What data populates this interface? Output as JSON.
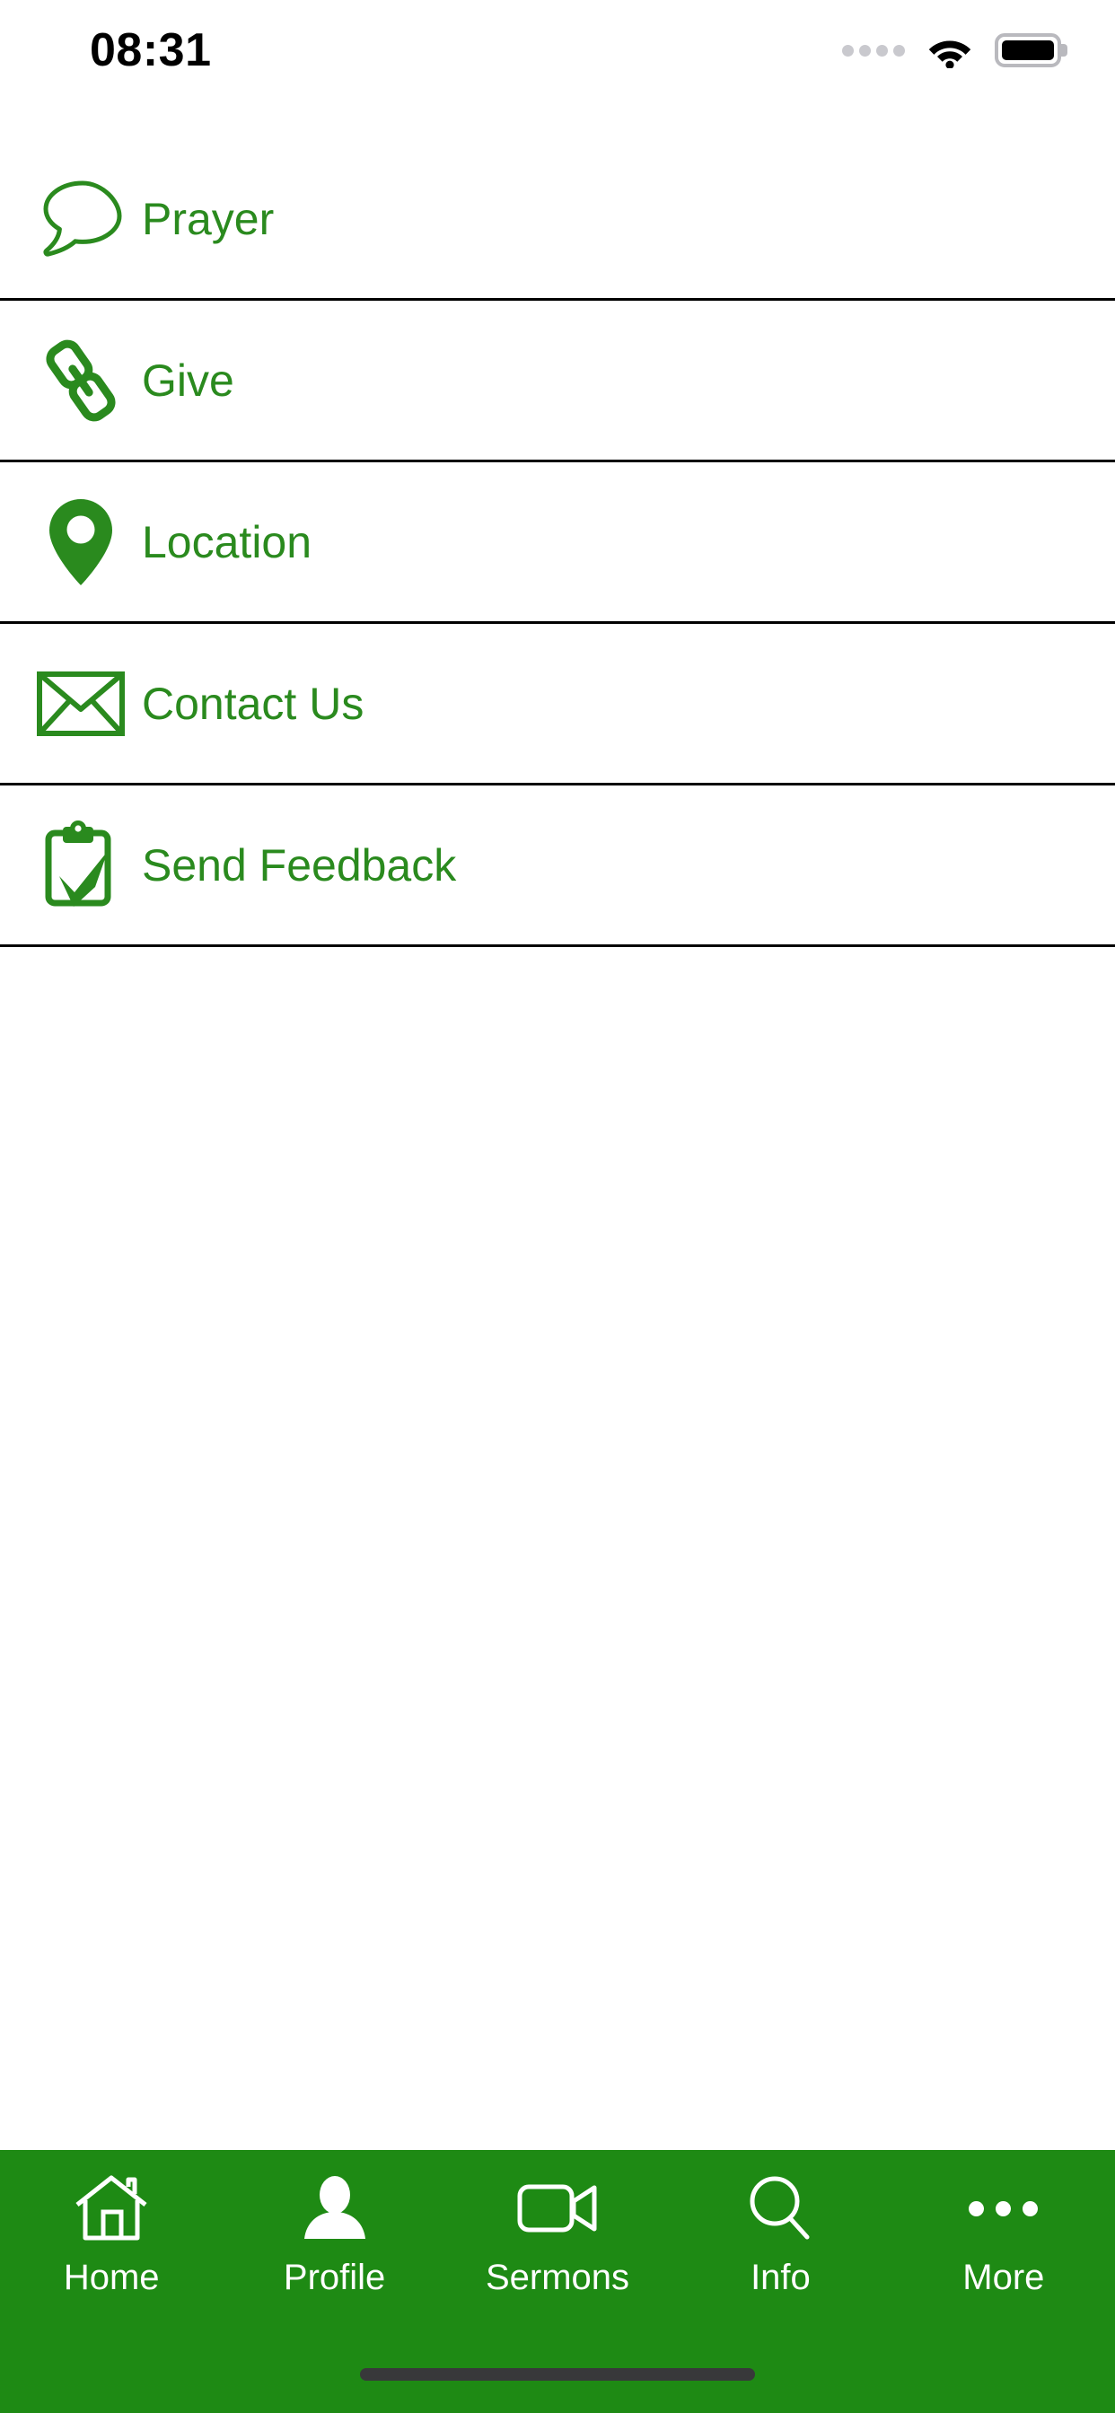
{
  "theme": {
    "brand_green": "#1e8a14",
    "text_green": "#2a8a1e",
    "divider": "#000000",
    "background": "#ffffff",
    "tab_label": "#ffffff",
    "home_indicator": "#38383a"
  },
  "status_bar": {
    "time": "08:31",
    "signal_icon": "signal-dots-icon",
    "wifi_icon": "wifi-icon",
    "battery_icon": "battery-full-icon"
  },
  "menu": {
    "items": [
      {
        "label": "Prayer",
        "icon": "speech-bubble-icon"
      },
      {
        "label": "Give",
        "icon": "chain-link-icon"
      },
      {
        "label": "Location",
        "icon": "map-pin-icon"
      },
      {
        "label": "Contact Us",
        "icon": "envelope-icon"
      },
      {
        "label": "Send Feedback",
        "icon": "clipboard-check-icon"
      }
    ]
  },
  "tabbar": {
    "items": [
      {
        "label": "Home",
        "icon": "house-icon"
      },
      {
        "label": "Profile",
        "icon": "person-icon"
      },
      {
        "label": "Sermons",
        "icon": "video-camera-icon"
      },
      {
        "label": "Info",
        "icon": "magnifier-icon"
      },
      {
        "label": "More",
        "icon": "ellipsis-icon"
      }
    ]
  }
}
